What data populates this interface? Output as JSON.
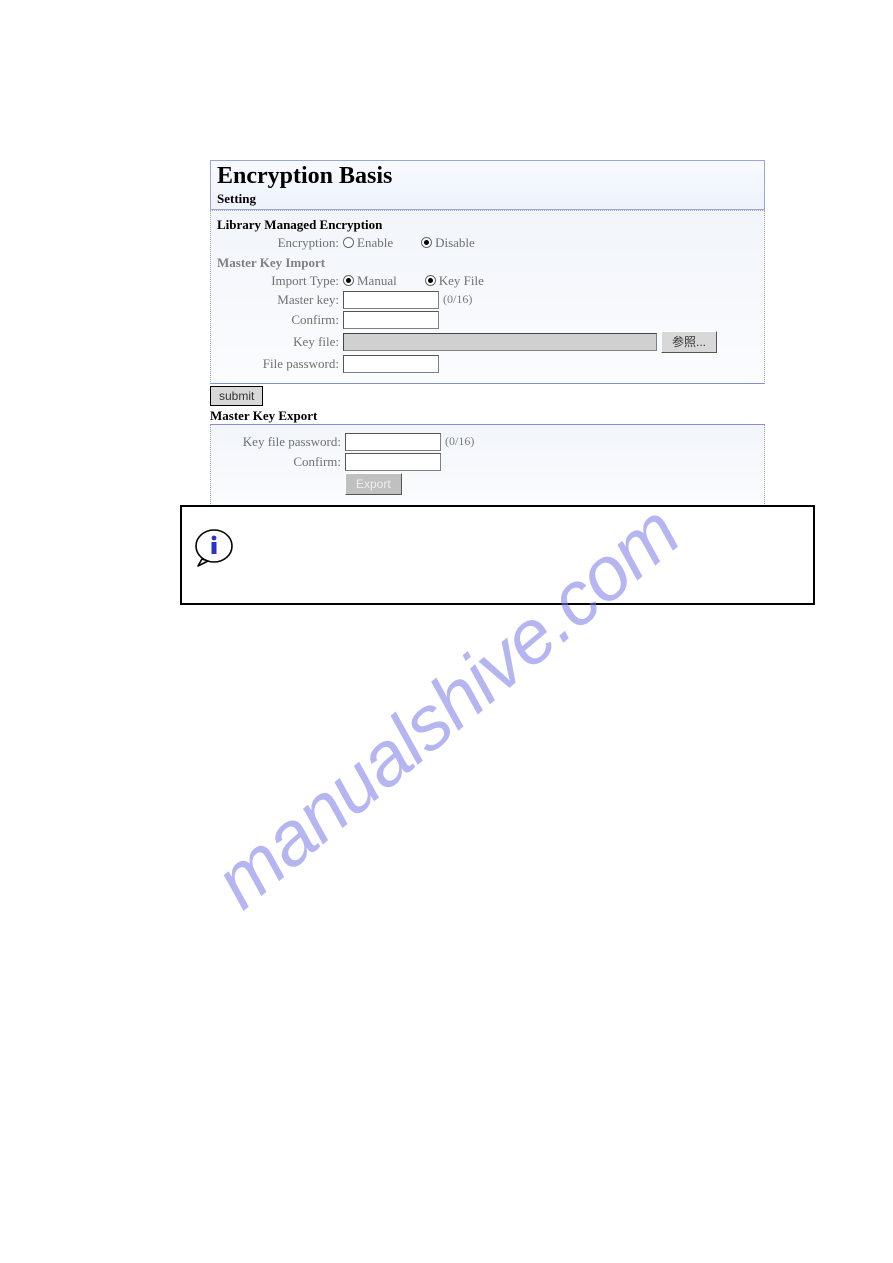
{
  "page_title": "Encryption Basis",
  "setting_label": "Setting",
  "section_lme": "Library Managed Encryption",
  "encryption_label": "Encryption:",
  "enable_label": "Enable",
  "disable_label": "Disable",
  "section_mki": "Master Key Import",
  "import_type_label": "Import Type:",
  "manual_label": "Manual",
  "keyfile_label": "Key File",
  "master_key_label": "Master key:",
  "master_key_hint": "(0/16)",
  "confirm_label": "Confirm:",
  "key_file_label": "Key file:",
  "browse_label": "参照...",
  "file_password_label": "File password:",
  "submit_label": "submit",
  "section_mke": "Master Key Export",
  "kf_password_label": "Key file password:",
  "kf_password_hint": "(0/16)",
  "export_label": "Export",
  "watermark": "manualshive.com"
}
